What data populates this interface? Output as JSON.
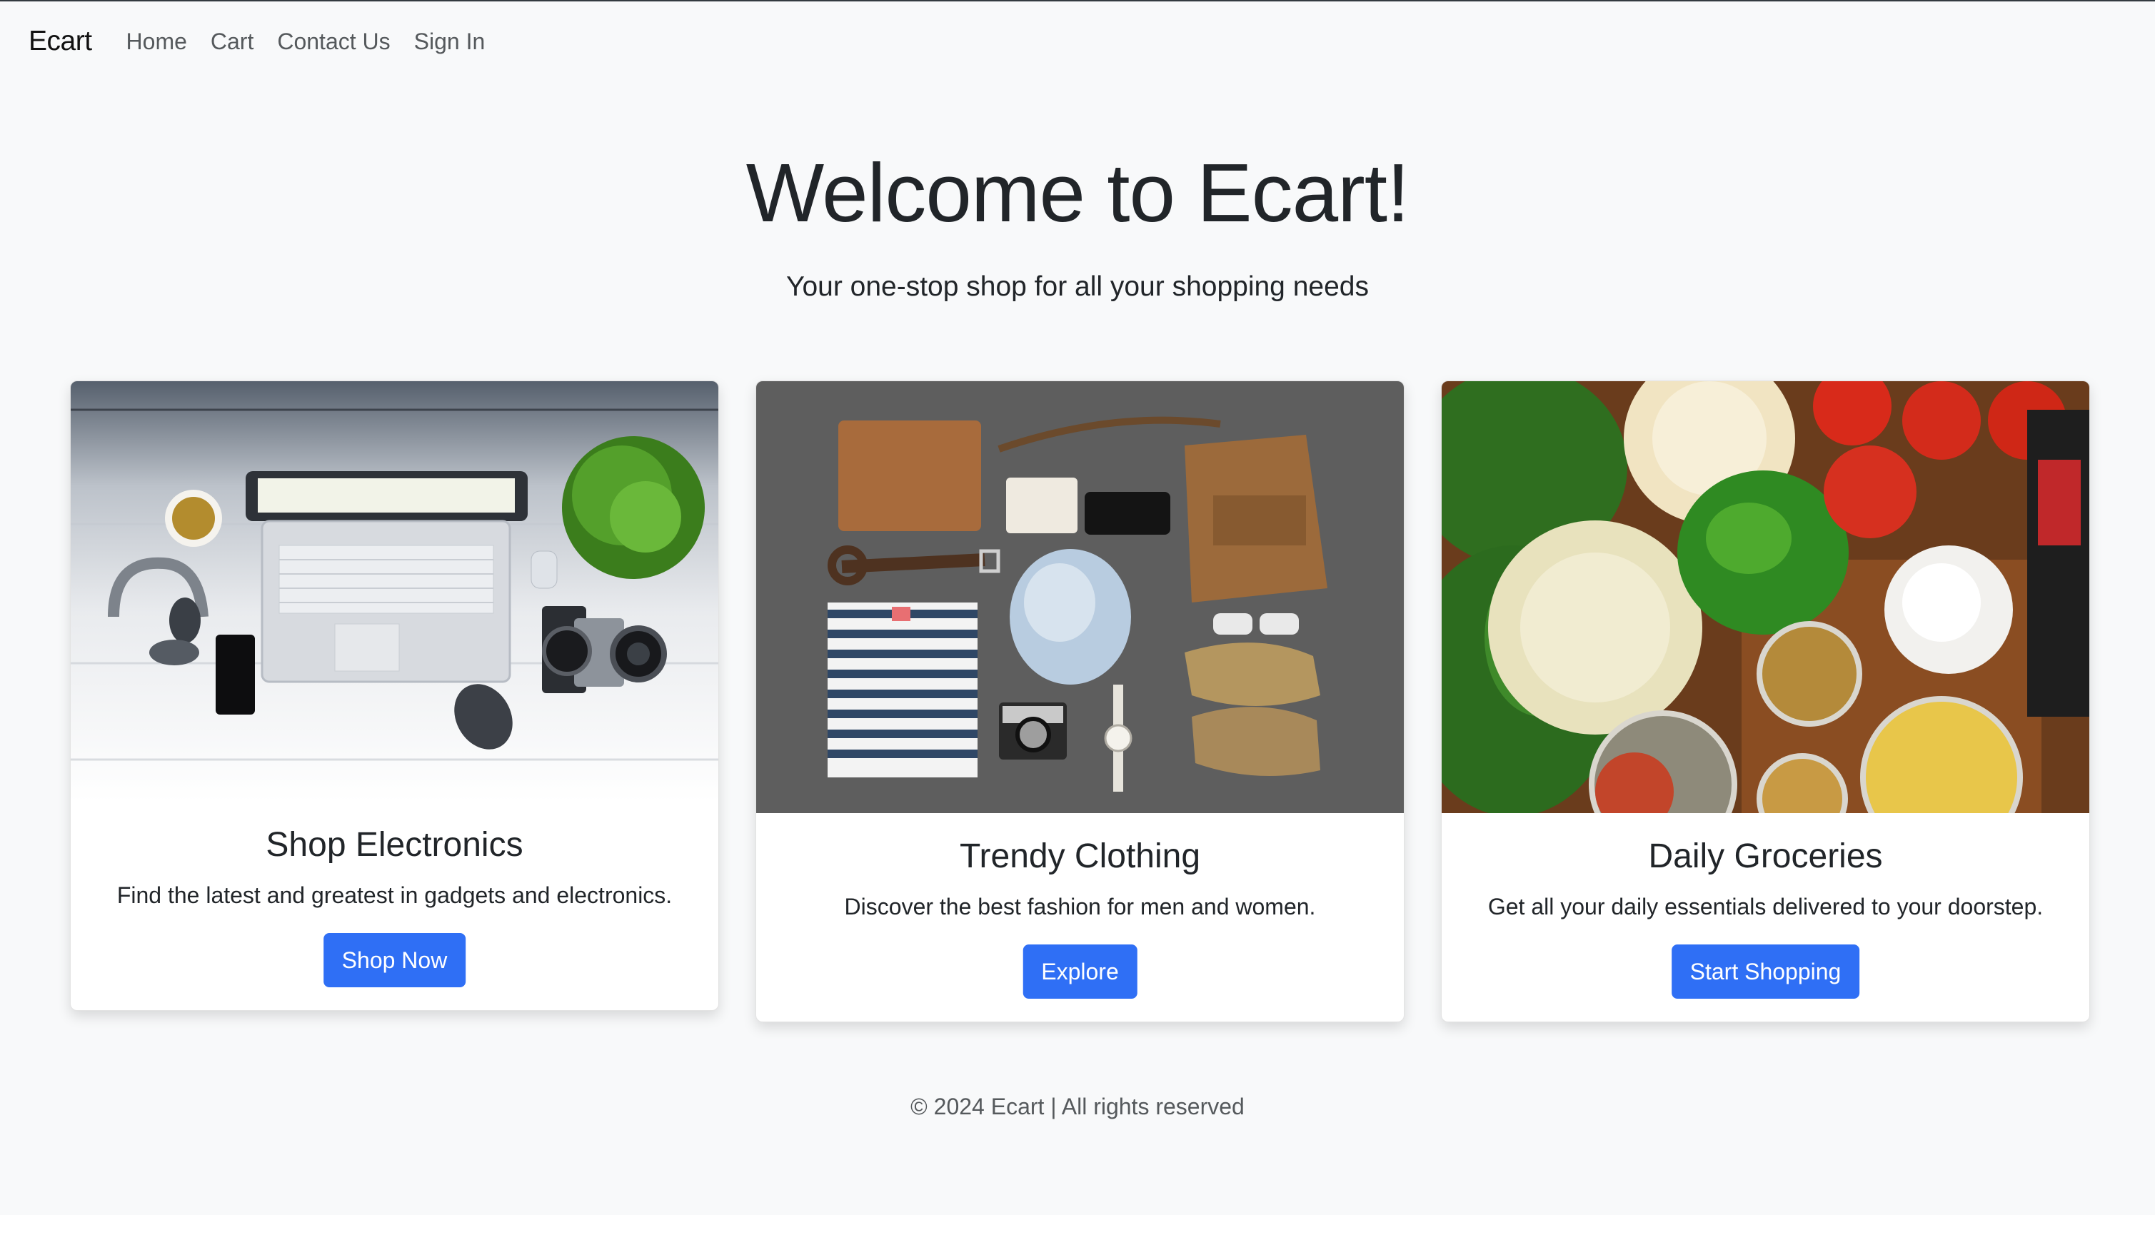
{
  "navbar": {
    "brand": "Ecart",
    "links": [
      "Home",
      "Cart",
      "Contact Us",
      "Sign In"
    ]
  },
  "hero": {
    "title": "Welcome to Ecart!",
    "subtitle": "Your one-stop shop for all your shopping needs"
  },
  "cards": [
    {
      "image_subject": "laptop-headphones-camera-flatlay",
      "title": "Shop Electronics",
      "text": "Find the latest and greatest in gadgets and electronics.",
      "button": "Shop Now"
    },
    {
      "image_subject": "clothing-bag-shoes-flatlay",
      "title": "Trendy Clothing",
      "text": "Discover the best fashion for men and women.",
      "button": "Explore"
    },
    {
      "image_subject": "vegetables-spices-flatlay",
      "title": "Daily Groceries",
      "text": "Get all your daily essentials delivered to your doorstep.",
      "button": "Start Shopping"
    }
  ],
  "footer": {
    "text": "© 2024 Ecart | All rights reserved"
  },
  "colors": {
    "page_background": "#f8f9fa",
    "primary_button": "#2f6ff5",
    "text": "#212529",
    "muted_text": "#55595c"
  }
}
